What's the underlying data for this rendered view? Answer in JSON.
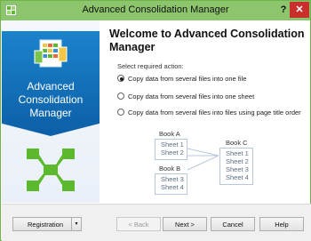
{
  "window": {
    "title": "Advanced Consolidation Manager",
    "help_label": "?",
    "close_label": "✕"
  },
  "sidebar": {
    "title_line1": "Advanced Consolidation",
    "title_line2": "Manager"
  },
  "main": {
    "title_line1": "Welcome to Advanced Consolidation",
    "title_line2": "Manager",
    "prompt": "Select required action:",
    "options": [
      {
        "label": "Copy data from several files into one file",
        "selected": true
      },
      {
        "label": "Copy data from several files into one sheet",
        "selected": false
      },
      {
        "label": "Copy data from several files into files using page title order",
        "selected": false
      }
    ]
  },
  "diagram": {
    "book_a": {
      "label": "Book A",
      "sheets": [
        "Sheet 1",
        "Sheet 2"
      ]
    },
    "book_b": {
      "label": "Book B",
      "sheets": [
        "Sheet 3",
        "Sheet 4"
      ]
    },
    "book_c": {
      "label": "Book C",
      "sheets": [
        "Sheet 1",
        "Sheet 2",
        "Sheet 3",
        "Sheet 4"
      ]
    }
  },
  "footer": {
    "registration_label": "Registration",
    "registration_arrow": "▾",
    "back_label": "< Back",
    "next_label": "Next >",
    "cancel_label": "Cancel",
    "help_label": "Help"
  },
  "colors": {
    "titlebar": "#8cc56b",
    "banner": "#1b83cc",
    "close": "#c9302c",
    "accent_green": "#5cb82c"
  }
}
